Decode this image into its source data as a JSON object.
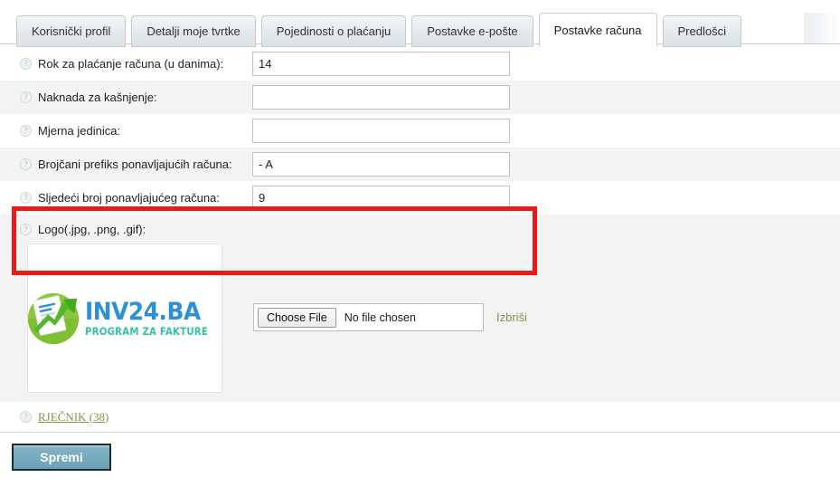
{
  "tabs": [
    {
      "label": "Korisnički profil",
      "active": false
    },
    {
      "label": "Detalji moje tvrtke",
      "active": false
    },
    {
      "label": "Pojedinosti o plaćanju",
      "active": false
    },
    {
      "label": "Postavke e-pošte",
      "active": false
    },
    {
      "label": "Postavke računa",
      "active": true
    },
    {
      "label": "Predlošci",
      "active": false
    }
  ],
  "help_icon_glyph": "?",
  "fields": [
    {
      "label": "Rok za plaćanje računa (u danima):",
      "value": "14",
      "placeholder": ""
    },
    {
      "label": "Naknada za kašnjenje:",
      "value": "",
      "placeholder": ""
    },
    {
      "label": "Mjerna jedinica:",
      "value": "",
      "placeholder": ""
    },
    {
      "label": "Brojčani prefiks ponavljajućih računa:",
      "value": "- A",
      "placeholder": ""
    },
    {
      "label": "Sljedeći broj ponavljajućeg računa:",
      "value": "9",
      "placeholder": ""
    }
  ],
  "logo_section": {
    "label": "Logo(.jpg, .png, .gif):",
    "logo_title": "INV24.BA",
    "logo_subtitle": "PROGRAM ZA FAKTURE",
    "choose_file_label": "Choose File",
    "no_file_text": "No file chosen",
    "delete_label": "Izbriši"
  },
  "dictionary": {
    "link_label": "RJEČNIK (38)"
  },
  "footer": {
    "save_label": "Spremi"
  },
  "colors": {
    "highlight": "#e81a1a",
    "link": "#8a8f4a",
    "logo_blue": "#2d8fd5",
    "logo_teal": "#35bfa0",
    "logo_green": "#8cc63f",
    "save_button": "#6ba2b7",
    "alt_row": "#f3f3f3"
  }
}
